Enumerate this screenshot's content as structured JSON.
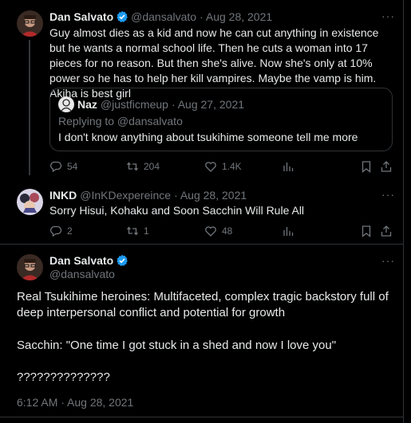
{
  "tweet1": {
    "name": "Dan Salvato",
    "handle": "@dansalvato",
    "date": "· Aug 28, 2021",
    "text": "Guy almost dies as a kid and now he can cut anything in existence but he wants a normal school life. Then he cuts a woman into 17 pieces for no reason. But then she's alive. Now she's only at 10% power so he has to help her kill vampires. Maybe the vamp is him. Akiha is best girl",
    "quote": {
      "name": "Naz",
      "handle": "@justficmeup",
      "date": "· Aug 27, 2021",
      "replying": "Replying to @dansalvato",
      "text": "I don't know anything about tsukihime someone tell me more"
    },
    "stats": {
      "replies": "54",
      "retweets": "204",
      "likes": "1.4K"
    }
  },
  "tweet2": {
    "name": "INKD",
    "handle": "@InKDexpereince",
    "date": "· Aug 28, 2021",
    "text": "Sorry Hisui, Kohaku and Soon Sacchin Will Rule All",
    "stats": {
      "replies": "2",
      "retweets": "1",
      "likes": "48"
    }
  },
  "tweet3": {
    "name": "Dan Salvato",
    "handle": "@dansalvato",
    "paragraph1": "Real Tsukihime heroines: Multifaceted, complex tragic backstory full of deep interpersonal conflict and potential for growth",
    "paragraph2": "Sacchin: \"One time I got stuck in a shed and now I love you\"",
    "paragraph3": "??????????????",
    "timestamp": "6:12 AM · Aug 28, 2021"
  },
  "colors": {
    "background": "#000000",
    "text": "#e7e9ea",
    "muted": "#71767b",
    "verified": "#1d9bf0",
    "border": "#2f3336"
  },
  "icons": [
    "verified-badge-icon",
    "more-icon",
    "reply-icon",
    "retweet-icon",
    "like-icon",
    "views-icon",
    "bookmark-icon",
    "share-icon"
  ]
}
